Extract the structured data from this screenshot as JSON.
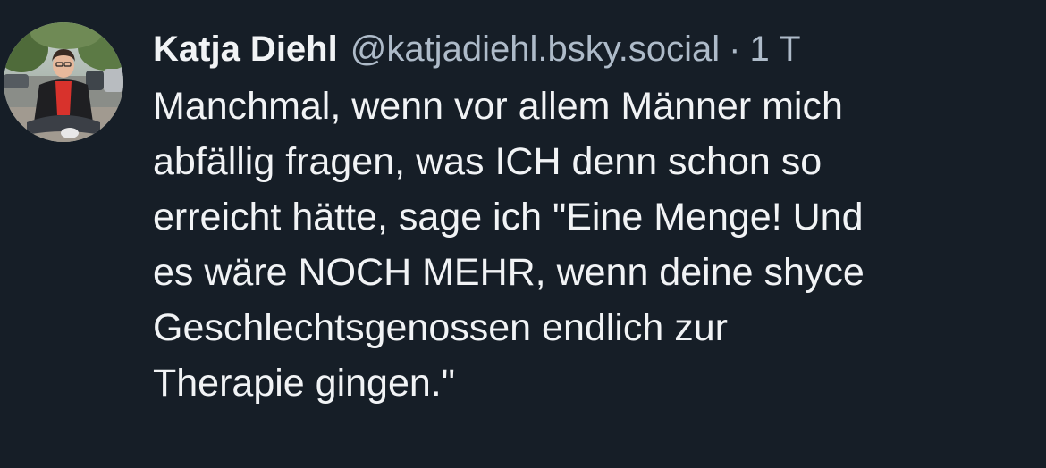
{
  "post": {
    "author": {
      "display_name": "Katja Diehl",
      "handle": "@katjadiehl.bsky.social",
      "avatar_icon": "profile-photo"
    },
    "separator": "·",
    "timestamp": "1 T",
    "text_lines": [
      "Manchmal, wenn vor allem Männer mich",
      "abfällig fragen, was ICH denn schon so",
      "erreicht hätte, sage ich \"Eine Menge! Und",
      "es wäre NOCH MEHR, wenn deine shyce",
      "Geschlechtsgenossen endlich zur",
      "Therapie gingen.\""
    ]
  },
  "theme": {
    "background": "#161e27",
    "text": "#f1f3f5",
    "muted": "#aebbc9"
  }
}
